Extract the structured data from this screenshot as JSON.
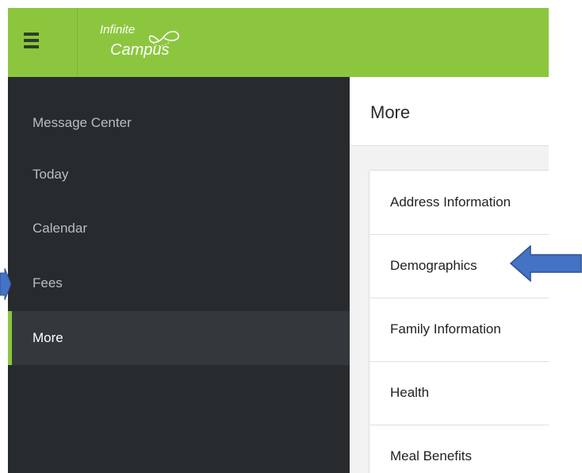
{
  "app": {
    "logo_line1": "Infinite",
    "logo_line2": "Campus",
    "brand_color": "#8cc63f"
  },
  "sidebar": {
    "items": [
      {
        "label": "Message Center",
        "active": false
      },
      {
        "label": "Today",
        "active": false
      },
      {
        "label": "Calendar",
        "active": false
      },
      {
        "label": "Fees",
        "active": false
      },
      {
        "label": "More",
        "active": true
      }
    ]
  },
  "content": {
    "title": "More",
    "items": [
      {
        "label": "Address Information"
      },
      {
        "label": "Demographics"
      },
      {
        "label": "Family Information"
      },
      {
        "label": "Health"
      },
      {
        "label": "Meal Benefits"
      }
    ]
  },
  "annotations": {
    "arrow_color": "#4472c4",
    "arrow_outline": "#2f528f"
  }
}
